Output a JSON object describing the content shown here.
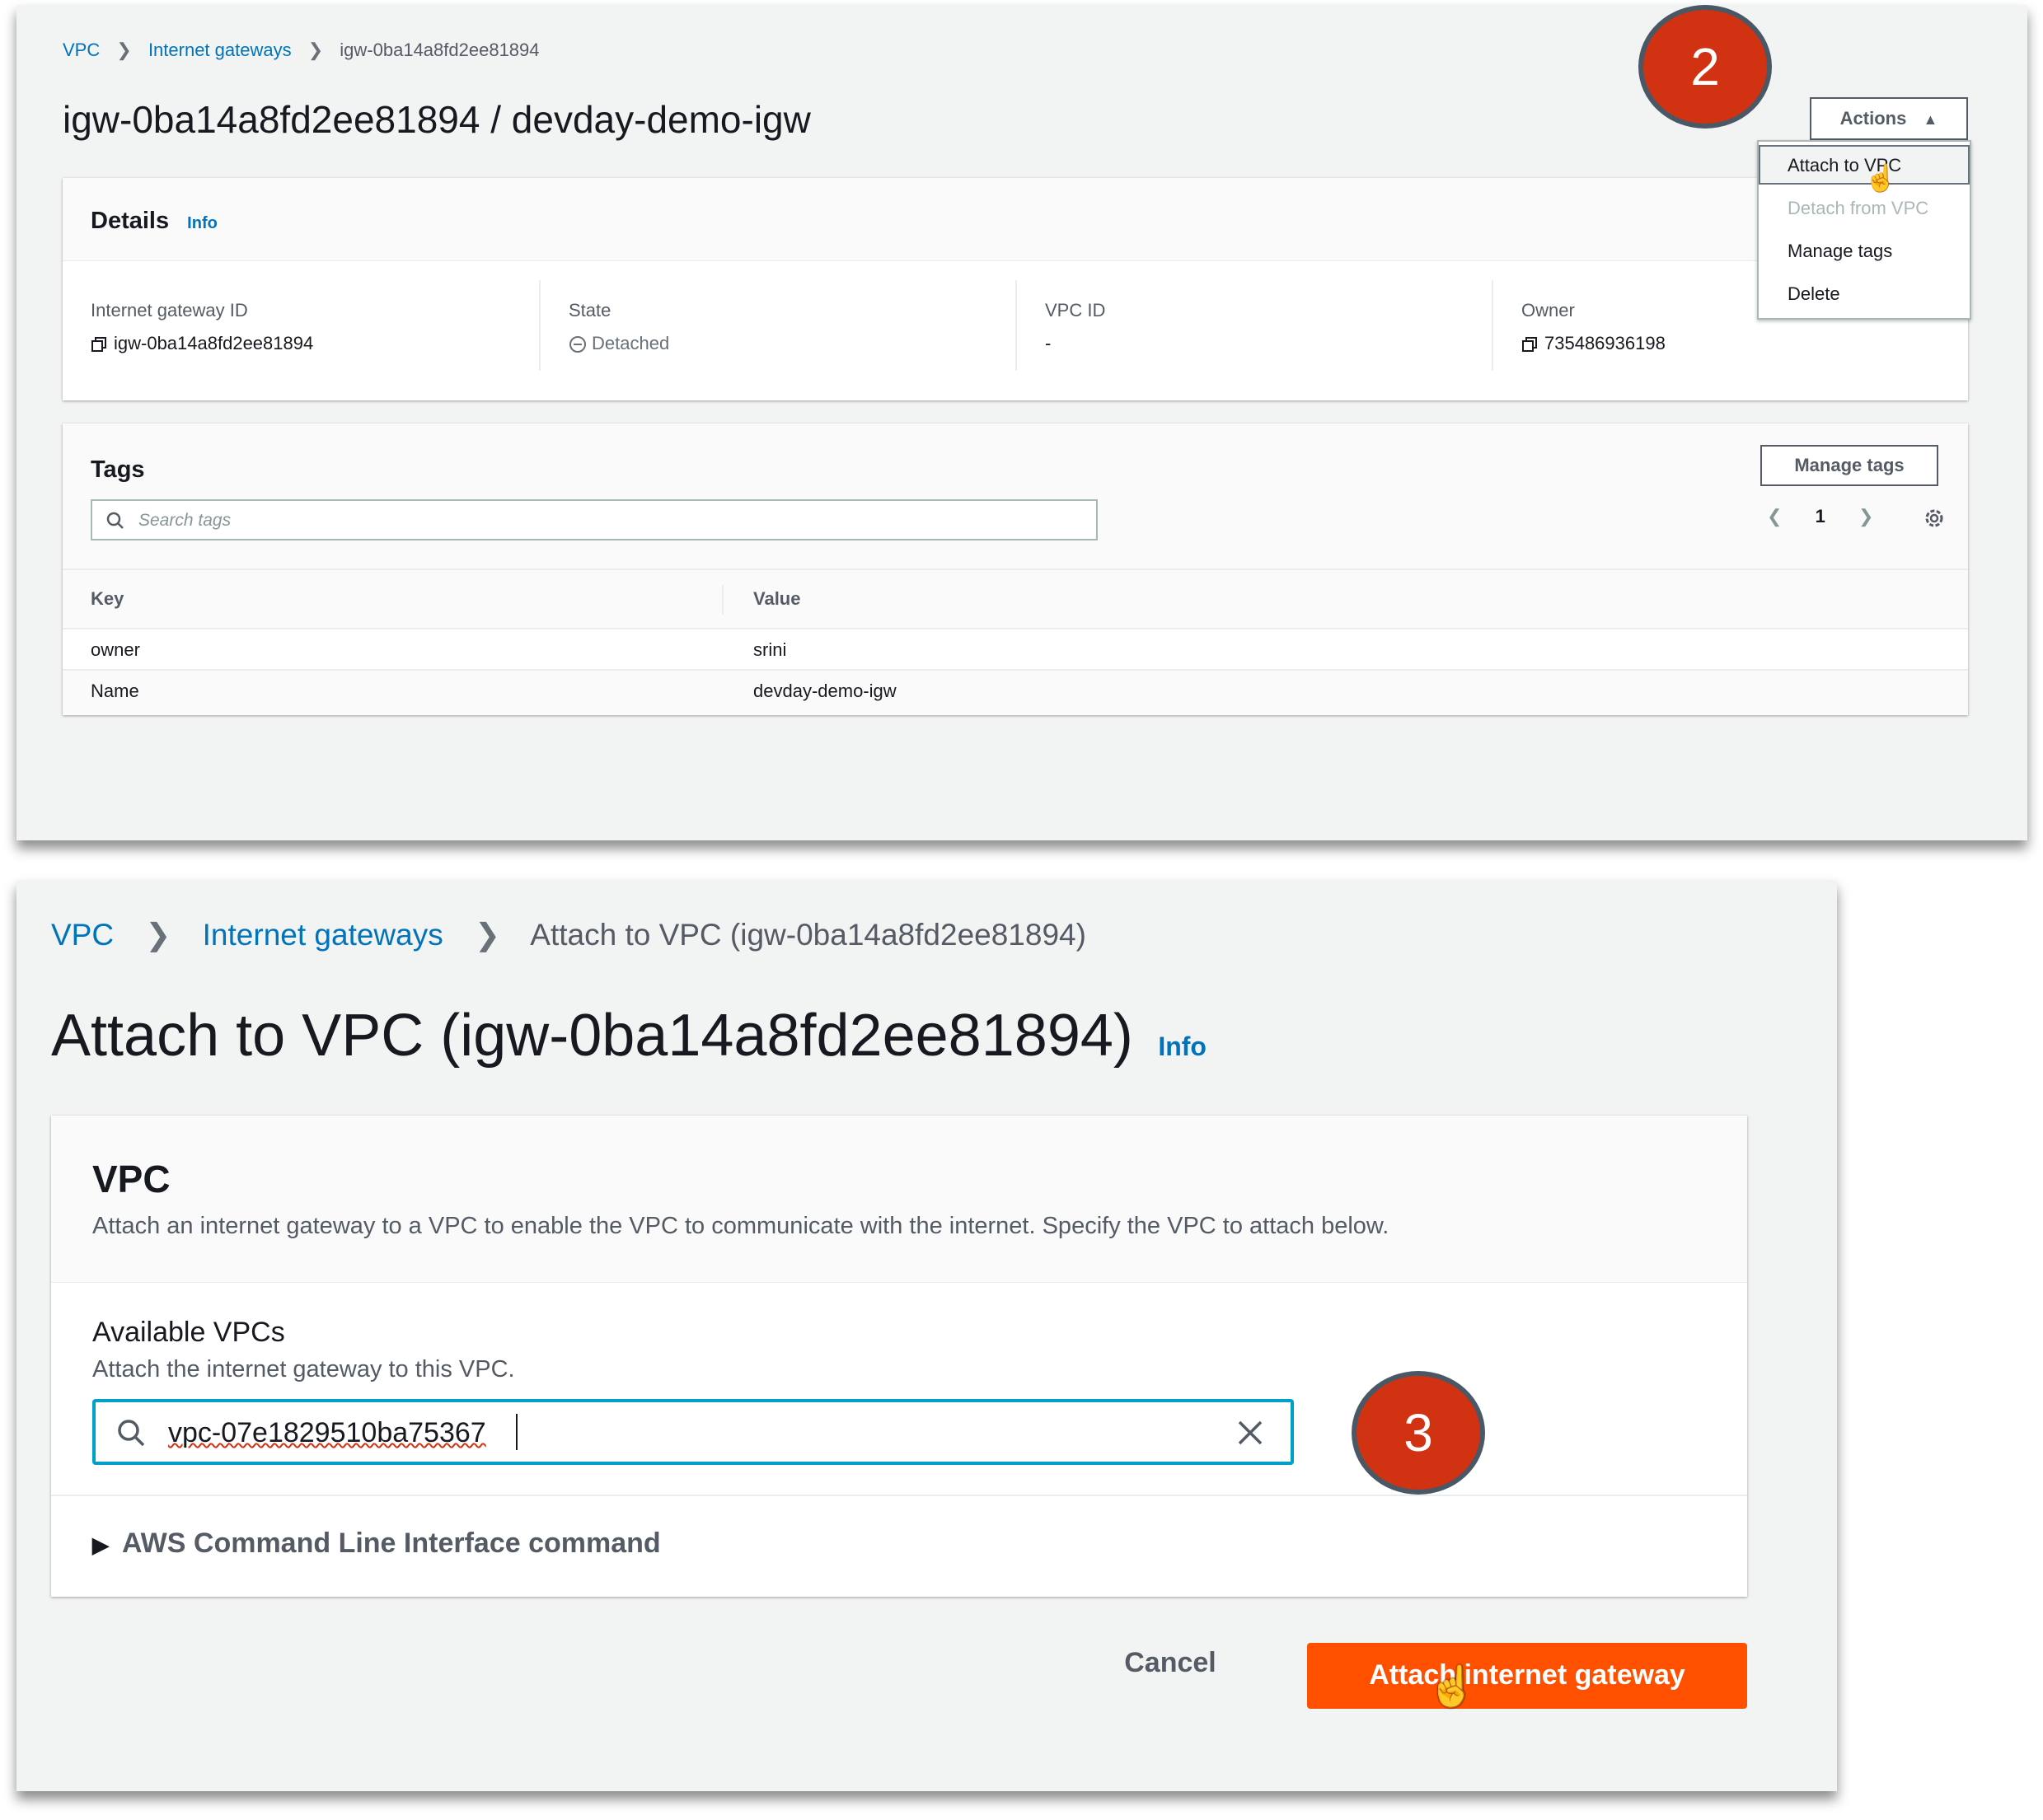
{
  "top": {
    "breadcrumb": {
      "vpc": "VPC",
      "gateways": "Internet gateways",
      "current": "igw-0ba14a8fd2ee81894"
    },
    "title": "igw-0ba14a8fd2ee81894 / devday-demo-igw",
    "actions_label": "Actions",
    "menu": {
      "attach": "Attach to VPC",
      "detach": "Detach from VPC",
      "manage_tags": "Manage tags",
      "delete": "Delete"
    },
    "details": {
      "heading": "Details",
      "info": "Info",
      "fields": [
        {
          "label": "Internet gateway ID",
          "value": "igw-0ba14a8fd2ee81894"
        },
        {
          "label": "State",
          "value": "Detached"
        },
        {
          "label": "VPC ID",
          "value": "-"
        },
        {
          "label": "Owner",
          "value": "735486936198"
        }
      ]
    },
    "tags": {
      "heading": "Tags",
      "manage_label": "Manage tags",
      "search_placeholder": "Search tags",
      "page": "1",
      "columns": {
        "key": "Key",
        "value": "Value"
      },
      "rows": [
        {
          "key": "owner",
          "value": "srini"
        },
        {
          "key": "Name",
          "value": "devday-demo-igw"
        }
      ]
    },
    "step_badge": "2"
  },
  "bottom": {
    "breadcrumb": {
      "vpc": "VPC",
      "gateways": "Internet gateways",
      "current": "Attach to VPC (igw-0ba14a8fd2ee81894)"
    },
    "title": "Attach to VPC (igw-0ba14a8fd2ee81894)",
    "info": "Info",
    "vpc_section": {
      "heading": "VPC",
      "description": "Attach an internet gateway to a VPC to enable the VPC to communicate with the internet. Specify the VPC to attach below."
    },
    "available": {
      "label": "Available VPCs",
      "description": "Attach the internet gateway to this VPC.",
      "value": "vpc-07e1829510ba75367"
    },
    "cli_label": "AWS Command Line Interface command",
    "cancel_label": "Cancel",
    "attach_label": "Attach internet gateway",
    "step_badge": "3"
  },
  "colors": {
    "link": "#0073bb",
    "primary": "#ff5000",
    "badge": "#d13212",
    "focus": "#00a1c9"
  }
}
